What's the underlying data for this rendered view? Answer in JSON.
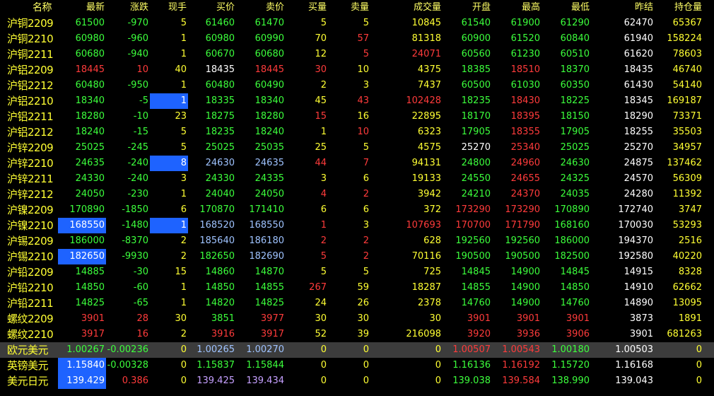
{
  "columns": [
    "名称",
    "最新",
    "涨跌",
    "现手",
    "买价",
    "卖价",
    "买量",
    "卖量",
    "成交量",
    "开盘",
    "最高",
    "最低",
    "昨结",
    "持仓量"
  ],
  "colors": {
    "red": "#ff3b3b",
    "green": "#3cff3c",
    "yellow": "#ffff33",
    "white": "#ffffff",
    "light_blue": "#9fc3ff",
    "violet": "#c6a0ff",
    "highlight": "#1e63ff",
    "selected_row": "#3c3c3c"
  },
  "rows": [
    {
      "cells": [
        "沪铜2209",
        "61500",
        "-970",
        "5",
        "61460",
        "61470",
        "5",
        "5",
        "10845",
        "61540",
        "61900",
        "61290",
        "62470",
        "65367"
      ],
      "colors": [
        "yellow",
        "green",
        "green",
        "yellow",
        "green",
        "green",
        "yellow",
        "yellow",
        "yellow",
        "green",
        "green",
        "green",
        "white",
        "yellow"
      ]
    },
    {
      "cells": [
        "沪铜2210",
        "60980",
        "-960",
        "1",
        "60980",
        "60990",
        "70",
        "57",
        "81318",
        "60900",
        "61520",
        "60840",
        "61940",
        "158224"
      ],
      "colors": [
        "yellow",
        "green",
        "green",
        "yellow",
        "green",
        "green",
        "yellow",
        "red",
        "yellow",
        "green",
        "green",
        "green",
        "white",
        "yellow"
      ]
    },
    {
      "cells": [
        "沪铜2211",
        "60680",
        "-940",
        "1",
        "60670",
        "60680",
        "12",
        "5",
        "24071",
        "60560",
        "61230",
        "60510",
        "61620",
        "78603"
      ],
      "colors": [
        "yellow",
        "green",
        "green",
        "yellow",
        "green",
        "green",
        "yellow",
        "red",
        "red",
        "green",
        "green",
        "green",
        "white",
        "yellow"
      ]
    },
    {
      "cells": [
        "沪铝2209",
        "18445",
        "10",
        "40",
        "18435",
        "18445",
        "30",
        "10",
        "4375",
        "18385",
        "18510",
        "18370",
        "18435",
        "46740"
      ],
      "colors": [
        "yellow",
        "red",
        "red",
        "yellow",
        "white",
        "red",
        "red",
        "yellow",
        "yellow",
        "green",
        "red",
        "green",
        "white",
        "yellow"
      ]
    },
    {
      "cells": [
        "沪铝2212",
        "60480",
        "-950",
        "1",
        "60480",
        "60490",
        "2",
        "3",
        "7437",
        "60500",
        "61030",
        "60350",
        "61430",
        "54140"
      ],
      "colors": [
        "yellow",
        "green",
        "green",
        "yellow",
        "green",
        "green",
        "yellow",
        "yellow",
        "yellow",
        "green",
        "green",
        "green",
        "white",
        "yellow"
      ]
    },
    {
      "cells": [
        "沪铝2210",
        "18340",
        "-5",
        "1",
        "18335",
        "18340",
        "45",
        "43",
        "102428",
        "18235",
        "18430",
        "18225",
        "18345",
        "169187"
      ],
      "colors": [
        "yellow",
        "green",
        "green",
        "white",
        "green",
        "green",
        "yellow",
        "red",
        "red",
        "green",
        "red",
        "green",
        "white",
        "yellow"
      ],
      "hl": [
        3
      ]
    },
    {
      "cells": [
        "沪铝2211",
        "18280",
        "-10",
        "23",
        "18275",
        "18280",
        "15",
        "16",
        "22895",
        "18170",
        "18395",
        "18150",
        "18290",
        "73371"
      ],
      "colors": [
        "yellow",
        "green",
        "green",
        "yellow",
        "green",
        "green",
        "red",
        "yellow",
        "yellow",
        "green",
        "red",
        "green",
        "white",
        "yellow"
      ]
    },
    {
      "cells": [
        "沪铝2212",
        "18240",
        "-15",
        "5",
        "18235",
        "18240",
        "1",
        "10",
        "6323",
        "17905",
        "18355",
        "17905",
        "18255",
        "35503"
      ],
      "colors": [
        "yellow",
        "green",
        "green",
        "yellow",
        "green",
        "green",
        "yellow",
        "red",
        "yellow",
        "green",
        "red",
        "green",
        "white",
        "yellow"
      ]
    },
    {
      "cells": [
        "沪锌2209",
        "25025",
        "-245",
        "5",
        "25025",
        "25035",
        "25",
        "5",
        "4575",
        "25270",
        "25340",
        "25025",
        "25270",
        "34957"
      ],
      "colors": [
        "yellow",
        "green",
        "green",
        "yellow",
        "green",
        "green",
        "yellow",
        "yellow",
        "yellow",
        "white",
        "red",
        "green",
        "white",
        "yellow"
      ]
    },
    {
      "cells": [
        "沪锌2210",
        "24635",
        "-240",
        "8",
        "24630",
        "24635",
        "44",
        "7",
        "94131",
        "24800",
        "24960",
        "24630",
        "24875",
        "137462"
      ],
      "colors": [
        "yellow",
        "green",
        "green",
        "white",
        "light_blue",
        "light_blue",
        "red",
        "red",
        "yellow",
        "green",
        "red",
        "green",
        "white",
        "yellow"
      ],
      "hl": [
        3
      ]
    },
    {
      "cells": [
        "沪锌2211",
        "24330",
        "-240",
        "3",
        "24330",
        "24335",
        "3",
        "6",
        "19133",
        "24550",
        "24655",
        "24325",
        "24570",
        "56309"
      ],
      "colors": [
        "yellow",
        "green",
        "green",
        "yellow",
        "green",
        "green",
        "yellow",
        "yellow",
        "yellow",
        "green",
        "red",
        "green",
        "white",
        "yellow"
      ]
    },
    {
      "cells": [
        "沪锌2212",
        "24050",
        "-230",
        "1",
        "24040",
        "24050",
        "4",
        "2",
        "3942",
        "24210",
        "24370",
        "24035",
        "24280",
        "11392"
      ],
      "colors": [
        "yellow",
        "green",
        "green",
        "yellow",
        "green",
        "green",
        "red",
        "red",
        "yellow",
        "green",
        "red",
        "green",
        "white",
        "yellow"
      ]
    },
    {
      "cells": [
        "沪镍2209",
        "170890",
        "-1850",
        "6",
        "170870",
        "171410",
        "6",
        "6",
        "372",
        "173290",
        "173290",
        "170890",
        "172740",
        "3747"
      ],
      "colors": [
        "yellow",
        "green",
        "green",
        "yellow",
        "green",
        "green",
        "yellow",
        "yellow",
        "yellow",
        "red",
        "red",
        "green",
        "white",
        "yellow"
      ]
    },
    {
      "cells": [
        "沪镍2210",
        "168550",
        "-1480",
        "1",
        "168520",
        "168550",
        "1",
        "3",
        "107693",
        "170700",
        "171790",
        "168160",
        "170030",
        "53293"
      ],
      "colors": [
        "yellow",
        "white",
        "green",
        "white",
        "light_blue",
        "light_blue",
        "red",
        "yellow",
        "red",
        "red",
        "red",
        "green",
        "white",
        "yellow"
      ],
      "hl": [
        1,
        3
      ]
    },
    {
      "cells": [
        "沪锡2209",
        "186000",
        "-8370",
        "2",
        "185640",
        "186180",
        "2",
        "2",
        "628",
        "192560",
        "192560",
        "186000",
        "194370",
        "2516"
      ],
      "colors": [
        "yellow",
        "green",
        "green",
        "yellow",
        "light_blue",
        "light_blue",
        "red",
        "red",
        "yellow",
        "green",
        "green",
        "green",
        "white",
        "yellow"
      ]
    },
    {
      "cells": [
        "沪锡2210",
        "182650",
        "-9930",
        "2",
        "182650",
        "182690",
        "5",
        "2",
        "70116",
        "190500",
        "190500",
        "182500",
        "192580",
        "40220"
      ],
      "colors": [
        "yellow",
        "white",
        "green",
        "yellow",
        "green",
        "light_blue",
        "red",
        "red",
        "yellow",
        "green",
        "green",
        "green",
        "white",
        "yellow"
      ],
      "hl": [
        1
      ]
    },
    {
      "cells": [
        "沪铅2209",
        "14885",
        "-30",
        "15",
        "14860",
        "14870",
        "5",
        "5",
        "725",
        "14845",
        "14900",
        "14845",
        "14915",
        "8328"
      ],
      "colors": [
        "yellow",
        "green",
        "green",
        "yellow",
        "green",
        "green",
        "yellow",
        "yellow",
        "yellow",
        "green",
        "green",
        "green",
        "white",
        "yellow"
      ]
    },
    {
      "cells": [
        "沪铅2210",
        "14850",
        "-60",
        "1",
        "14850",
        "14855",
        "267",
        "59",
        "18287",
        "14855",
        "14900",
        "14850",
        "14910",
        "62662"
      ],
      "colors": [
        "yellow",
        "green",
        "green",
        "yellow",
        "green",
        "green",
        "red",
        "yellow",
        "yellow",
        "green",
        "green",
        "green",
        "white",
        "yellow"
      ]
    },
    {
      "cells": [
        "沪铅2211",
        "14825",
        "-65",
        "1",
        "14820",
        "14825",
        "24",
        "26",
        "2378",
        "14760",
        "14900",
        "14760",
        "14890",
        "13095"
      ],
      "colors": [
        "yellow",
        "green",
        "green",
        "yellow",
        "green",
        "green",
        "yellow",
        "yellow",
        "yellow",
        "green",
        "green",
        "green",
        "white",
        "yellow"
      ]
    },
    {
      "cells": [
        "螺纹2209",
        "3901",
        "28",
        "30",
        "3851",
        "3977",
        "30",
        "30",
        "30",
        "3901",
        "3901",
        "3901",
        "3873",
        "1891"
      ],
      "colors": [
        "yellow",
        "red",
        "red",
        "yellow",
        "green",
        "red",
        "yellow",
        "yellow",
        "yellow",
        "red",
        "red",
        "red",
        "white",
        "yellow"
      ]
    },
    {
      "cells": [
        "螺纹2210",
        "3917",
        "16",
        "2",
        "3916",
        "3917",
        "52",
        "39",
        "216098",
        "3920",
        "3936",
        "3906",
        "3901",
        "681263"
      ],
      "colors": [
        "yellow",
        "red",
        "red",
        "yellow",
        "red",
        "red",
        "yellow",
        "yellow",
        "yellow",
        "red",
        "red",
        "red",
        "white",
        "yellow"
      ]
    },
    {
      "cells": [
        "欧元美元",
        "1.00267",
        "-0.00236",
        "0",
        "1.00265",
        "1.00270",
        "0",
        "0",
        "0",
        "1.00507",
        "1.00543",
        "1.00180",
        "1.00503",
        "0"
      ],
      "colors": [
        "yellow",
        "green",
        "green",
        "yellow",
        "light_blue",
        "light_blue",
        "yellow",
        "yellow",
        "yellow",
        "red",
        "red",
        "green",
        "white",
        "yellow"
      ],
      "selected": true
    },
    {
      "cells": [
        "英镑美元",
        "1.15840",
        "-0.00328",
        "0",
        "1.15837",
        "1.15844",
        "0",
        "0",
        "0",
        "1.16136",
        "1.16192",
        "1.15720",
        "1.16168",
        "0"
      ],
      "colors": [
        "yellow",
        "white",
        "green",
        "yellow",
        "green",
        "green",
        "yellow",
        "yellow",
        "yellow",
        "green",
        "red",
        "green",
        "white",
        "yellow"
      ],
      "hl": [
        1
      ]
    },
    {
      "cells": [
        "美元日元",
        "139.429",
        "0.386",
        "0",
        "139.425",
        "139.434",
        "0",
        "0",
        "0",
        "139.038",
        "139.584",
        "138.990",
        "139.043",
        "0"
      ],
      "colors": [
        "yellow",
        "white",
        "red",
        "yellow",
        "violet",
        "violet",
        "yellow",
        "yellow",
        "yellow",
        "green",
        "red",
        "green",
        "white",
        "yellow"
      ],
      "hl": [
        1
      ]
    }
  ]
}
